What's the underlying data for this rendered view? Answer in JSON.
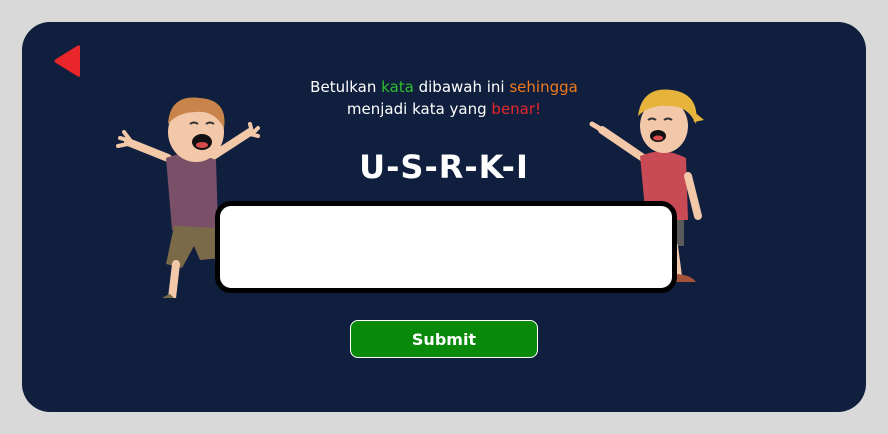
{
  "instruction": {
    "part1": "Betulkan ",
    "kata": "kata",
    "part2": " dibawah ini ",
    "sehingga": "sehingga",
    "part3": "menjadi kata yang ",
    "benar": "benar!"
  },
  "scrambled_word": "U-S-R-K-I",
  "answer_input": {
    "value": "",
    "placeholder": ""
  },
  "submit_label": "Submit",
  "icons": {
    "back": "back-arrow-icon"
  },
  "colors": {
    "background": "#d9d9d9",
    "panel": "#0f1f3d",
    "green": "#2fbf2f",
    "orange": "#f07a1a",
    "red": "#e8262c",
    "submit": "#0a8a0a"
  }
}
